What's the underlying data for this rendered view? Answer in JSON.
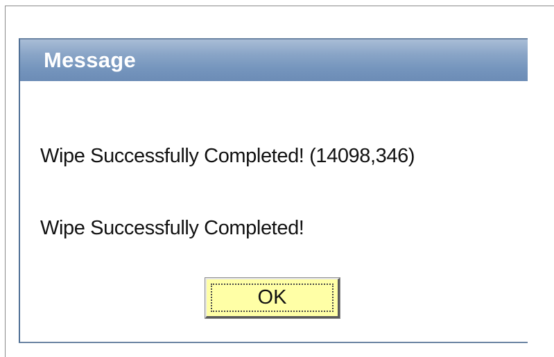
{
  "dialog": {
    "title": "Message",
    "messages": [
      "Wipe Successfully Completed! (14098,346)",
      "Wipe Successfully Completed!"
    ],
    "ok_button_label": "OK"
  },
  "colors": {
    "header_gradient_top": "#a9bdd6",
    "header_gradient_bottom": "#6c8cb6",
    "button_background": "#ffffa6"
  }
}
